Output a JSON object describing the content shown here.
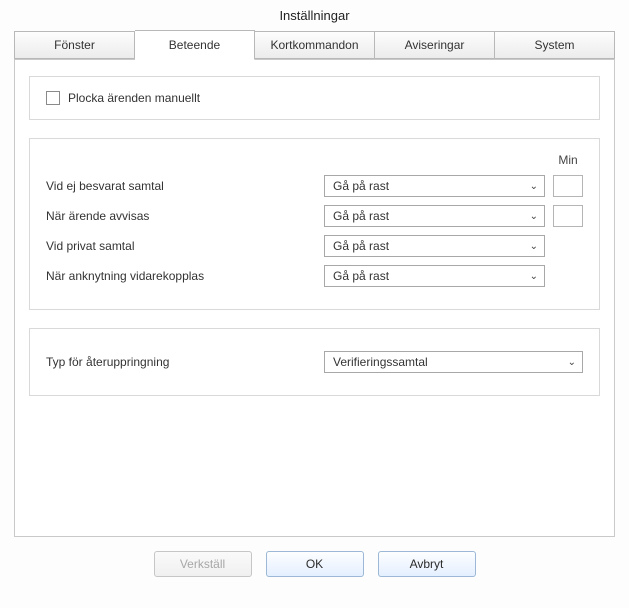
{
  "title": "Inställningar",
  "tabs": [
    {
      "label": "Fönster"
    },
    {
      "label": "Beteende"
    },
    {
      "label": "Kortkommandon"
    },
    {
      "label": "Aviseringar"
    },
    {
      "label": "System"
    }
  ],
  "active_tab_index": 1,
  "group_manual": {
    "checkbox_label": "Plocka ärenden manuellt",
    "checked": false
  },
  "group_actions": {
    "min_header": "Min",
    "rows": [
      {
        "label": "Vid ej besvarat samtal",
        "value": "Gå på rast",
        "has_min": true,
        "min_value": ""
      },
      {
        "label": "När ärende avvisas",
        "value": "Gå på rast",
        "has_min": true,
        "min_value": ""
      },
      {
        "label": "Vid privat samtal",
        "value": "Gå på rast",
        "has_min": false
      },
      {
        "label": "När anknytning vidarekopplas",
        "value": "Gå på rast",
        "has_min": false
      }
    ]
  },
  "group_callback": {
    "label": "Typ för återuppringning",
    "value": "Verifieringssamtal"
  },
  "buttons": {
    "apply": "Verkställ",
    "ok": "OK",
    "cancel": "Avbryt"
  }
}
